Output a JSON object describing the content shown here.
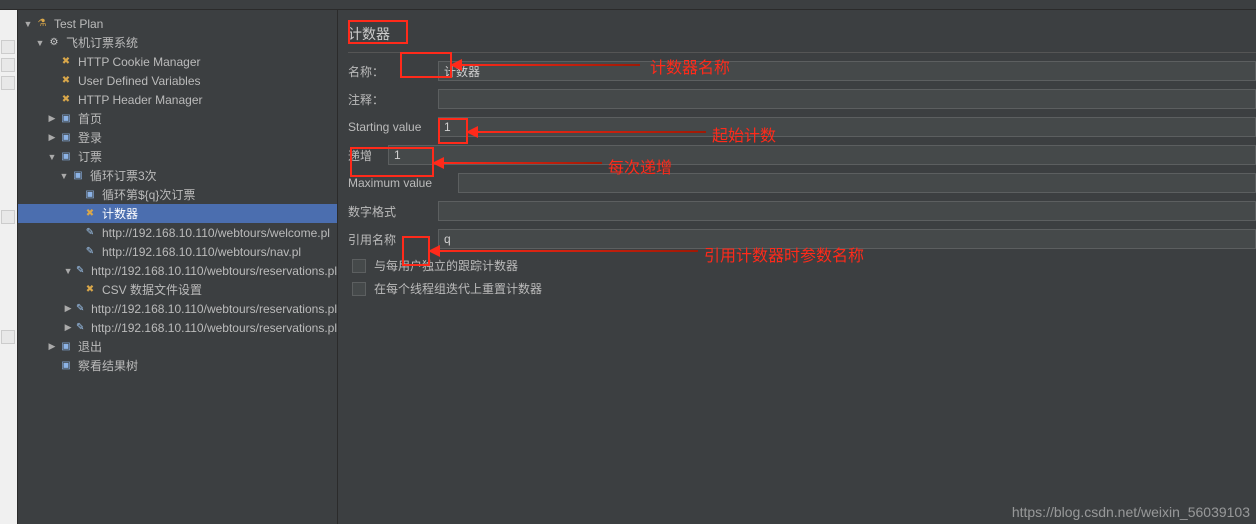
{
  "tree": {
    "root": "Test Plan",
    "item1": "飞机订票系统",
    "item2": "HTTP Cookie Manager",
    "item3": "User Defined Variables",
    "item4": "HTTP Header Manager",
    "item5": "首页",
    "item6": "登录",
    "item7": "订票",
    "item8": "循环订票3次",
    "item9": "循环第${q}次订票",
    "item10": "计数器",
    "item11": "http://192.168.10.110/webtours/welcome.pl",
    "item12": "http://192.168.10.110/webtours/nav.pl",
    "item13": "http://192.168.10.110/webtours/reservations.pl",
    "item14": "CSV 数据文件设置",
    "item15": "http://192.168.10.110/webtours/reservations.pl",
    "item16": "http://192.168.10.110/webtours/reservations.pl",
    "item17": "退出",
    "item18": "察看结果树"
  },
  "panel": {
    "title": "计数器",
    "name_label": "名称：",
    "name_value": "计数器",
    "comment_label": "注释：",
    "comment_value": "",
    "start_label": "Starting value",
    "start_value": "1",
    "incr_label": "递增",
    "incr_value": "1",
    "max_label": "Maximum value",
    "max_value": "",
    "format_label": "数字格式",
    "format_value": "",
    "ref_label": "引用名称",
    "ref_value": "q",
    "chk1": "与每用户独立的跟踪计数器",
    "chk2": "在每个线程组迭代上重置计数器"
  },
  "annotations": {
    "a1": "计数器名称",
    "a2": "起始计数",
    "a3": "每次递增",
    "a4": "引用计数器时参数名称"
  },
  "watermark": "https://blog.csdn.net/weixin_56039103"
}
